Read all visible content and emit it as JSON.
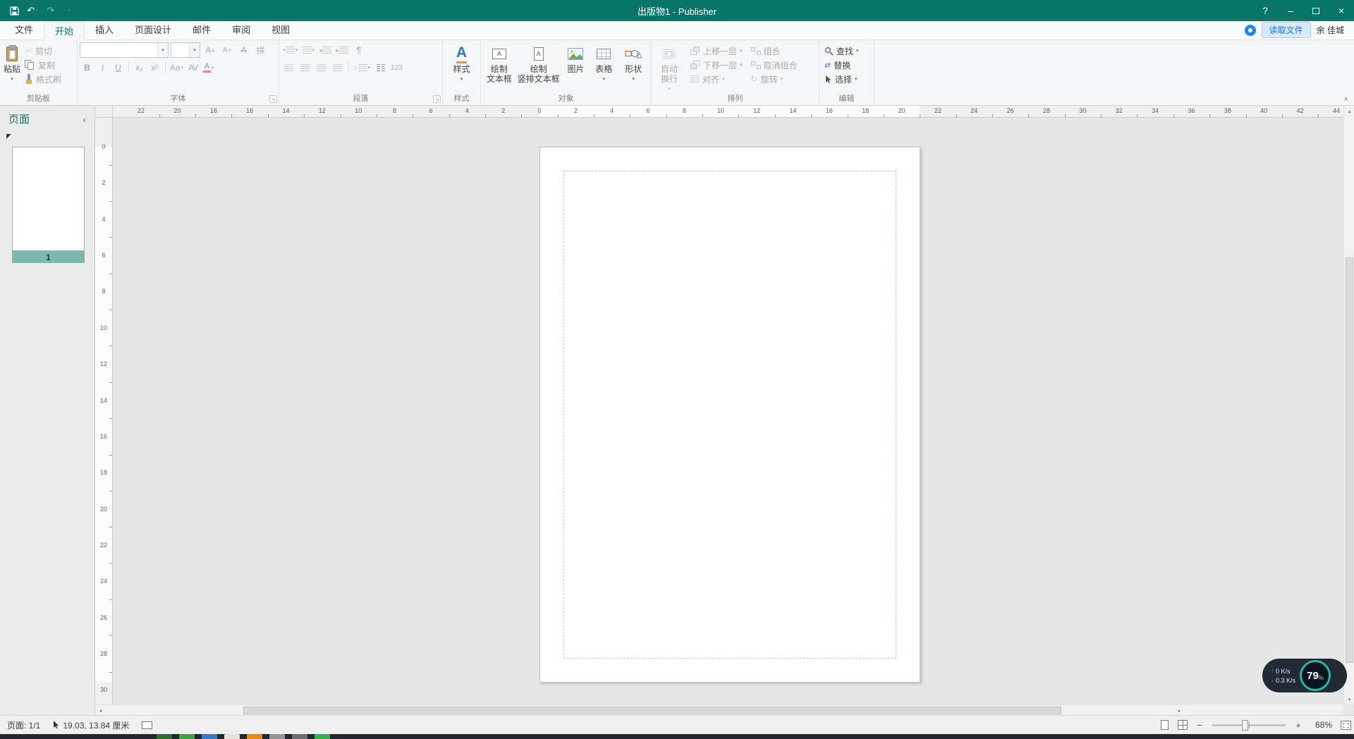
{
  "accent_color": "#077568",
  "titlebar": {
    "title": "出版物1 - Publisher"
  },
  "tabs": [
    {
      "name": "file",
      "label": "文件",
      "active": false
    },
    {
      "name": "home",
      "label": "开始",
      "active": true
    },
    {
      "name": "insert",
      "label": "插入",
      "active": false
    },
    {
      "name": "page-design",
      "label": "页面设计",
      "active": false
    },
    {
      "name": "mailings",
      "label": "邮件",
      "active": false
    },
    {
      "name": "review",
      "label": "审阅",
      "active": false
    },
    {
      "name": "view",
      "label": "视图",
      "active": false
    }
  ],
  "tab_right": {
    "read_file": "读取文件",
    "user": "余 佳城"
  },
  "ribbon": {
    "clipboard": {
      "label": "剪贴板",
      "paste": "粘贴",
      "cut": "剪切",
      "copy": "复制",
      "format_painter": "格式刷"
    },
    "font": {
      "label": "字体",
      "phonetic": "拼"
    },
    "paragraph": {
      "label": "段落",
      "num_styles": "123"
    },
    "styles": {
      "label": "样式",
      "button": "样式",
      "icon_letter": "A"
    },
    "objects": {
      "label": "对象",
      "draw_tb1": "绘制",
      "draw_tb2": "文本框",
      "draw_vtb1": "绘制",
      "draw_vtb2": "竖排文本框",
      "picture": "图片",
      "table": "表格",
      "shapes": "形状",
      "letter": "A"
    },
    "arrange": {
      "label": "排列",
      "wrap1": "自动",
      "wrap2": "换行",
      "bring_forward": "上移一层",
      "send_backward": "下移一层",
      "align": "对齐",
      "group": "组合",
      "ungroup": "取消组合",
      "rotate": "旋转"
    },
    "editing": {
      "label": "编辑",
      "find": "查找",
      "replace": "替换",
      "select": "选择"
    }
  },
  "pages_panel": {
    "title": "页面",
    "page_number": "1"
  },
  "rulers": {
    "h_numbers": [
      "22",
      "20",
      "18",
      "16",
      "14",
      "12",
      "10",
      "8",
      "6",
      "4",
      "2",
      "0",
      "2",
      "4",
      "6",
      "8",
      "10",
      "12",
      "14",
      "16",
      "18",
      "20",
      "22",
      "24",
      "26",
      "28",
      "30",
      "32",
      "34",
      "36",
      "38",
      "40",
      "42",
      "44"
    ],
    "v_numbers": [
      "0",
      "2",
      "4",
      "6",
      "8",
      "10",
      "12",
      "14",
      "16",
      "18",
      "20",
      "22",
      "24",
      "26",
      "28",
      "30"
    ]
  },
  "status_bar": {
    "page": "页面: 1/1",
    "coords": "19.03, 13.84 厘米",
    "zoom": "68%"
  },
  "overlay": {
    "up_speed": "0 K/s",
    "down_speed": "0.3 K/s",
    "value": "79",
    "unit": "%"
  },
  "taskbar_colors": [
    "#2F6B35",
    "#43A047",
    "#3B78C8",
    "#E9E4DA",
    "#E8890C",
    "#969696",
    "#6F6F6F",
    "#33B14E"
  ],
  "glyphs": {
    "down": "▾",
    "up": "▴",
    "left": "◂",
    "right": "▸",
    "undo": "↶",
    "redo": "↷",
    "help": "?",
    "minimize": "–",
    "close": "×",
    "collapse": "∧",
    "panel_collapse": "‹",
    "launcher": "↘",
    "cut": "✂",
    "bold": "B",
    "italic": "I",
    "underline": "U",
    "subscript": "x₂",
    "superscript": "x²",
    "change_case": "Aa",
    "char_spacing": "AV",
    "font_color": "A",
    "bullet": "•",
    "pilcrow": "¶",
    "line_spacing": "↕",
    "rotate": "↻",
    "replace_swap": "⇄",
    "zoom_out": "−",
    "zoom_in": "+",
    "arrow_up": "↑",
    "arrow_down": "↓"
  }
}
